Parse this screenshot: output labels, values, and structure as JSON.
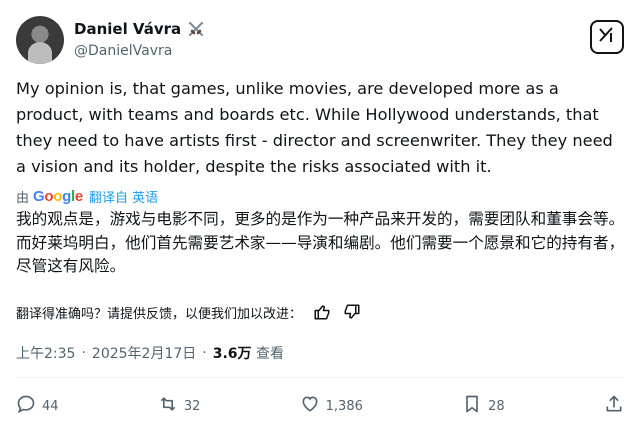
{
  "author": {
    "display_name": "Daniel Vávra",
    "badge_icon": "crossed-swords-icon",
    "handle": "@DanielVavra"
  },
  "tweet": {
    "text": "My opinion is, that games, unlike movies, are developed more as a product, with teams and boards etc. While Hollywood understands, that they need to have artists first - director and screenwriter. They they need a vision and its holder, despite the risks associated with it."
  },
  "translation": {
    "by_label": "由",
    "google": "Google",
    "link_label": "翻译自 英语",
    "text": "我的观点是，游戏与电影不同，更多的是作为一种产品来开发的，需要团队和董事会等。而好莱坞明白，他们首先需要艺术家——导演和编剧。他们需要一个愿景和它的持有者，尽管这有风险。",
    "feedback_prompt": "翻译得准确吗？请提供反馈，以便我们加以改进："
  },
  "meta": {
    "time": "上午2:35",
    "separator1": "·",
    "date": "2025年2月17日",
    "separator2": "·",
    "views_count": "3.6万",
    "views_label": "查看"
  },
  "actions": {
    "replies": "44",
    "retweets": "32",
    "likes": "1,386",
    "bookmarks": "28"
  },
  "colors": {
    "text_primary": "#0f1419",
    "text_secondary": "#536471",
    "link": "#1d9bf0",
    "divider": "#eff3f4"
  }
}
